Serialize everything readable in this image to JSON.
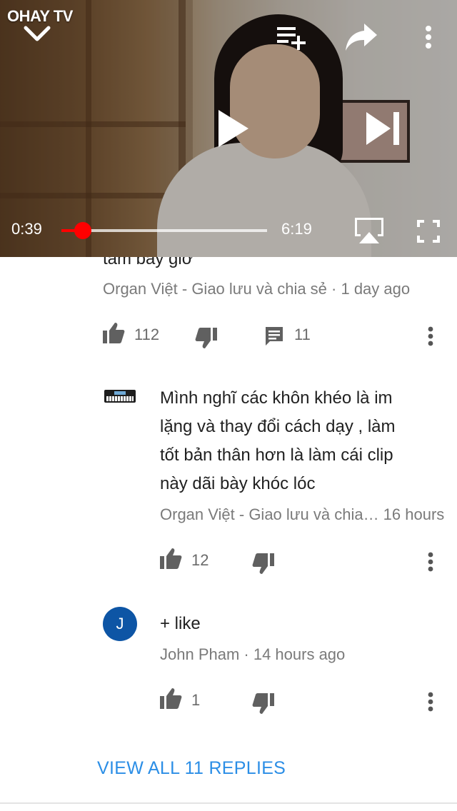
{
  "player": {
    "logo": "OHAY TV",
    "current_time": "0:39",
    "duration": "6:19",
    "progress_fraction": 0.105,
    "icons": [
      "chevron-down-icon",
      "add-to-playlist-icon",
      "share-icon",
      "more-vert-icon",
      "play-icon",
      "skip-next-icon",
      "airplay-icon",
      "fullscreen-icon"
    ]
  },
  "comments": [
    {
      "text_lines": [
        "tâm bây giờ"
      ],
      "meta": "Organ Việt - Giao lưu và chia sẻ · 1 day ago",
      "likes": "112",
      "replies": "11",
      "partial": true
    },
    {
      "avatar": "keyboard-avatar",
      "text_lines": [
        "Mình nghĩ các khôn khéo là im",
        "lặng và thay đổi cách dạy , làm",
        "tốt bản thân hơn là làm cái clip",
        "này dãi bày khóc lóc"
      ],
      "meta": "Organ Việt - Giao lưu và chia…   16 hours",
      "likes": "12"
    },
    {
      "avatar_letter": "J",
      "avatar_color": "#0d55a5",
      "text_lines": [
        "+ like"
      ],
      "meta": "John Pham · 14 hours ago",
      "likes": "1"
    }
  ],
  "view_all_label": "VIEW ALL 11 REPLIES",
  "colors": {
    "accent_blue": "#2b8ee6",
    "progress_red": "#ff0000",
    "avatar_blue": "#0d55a5"
  }
}
